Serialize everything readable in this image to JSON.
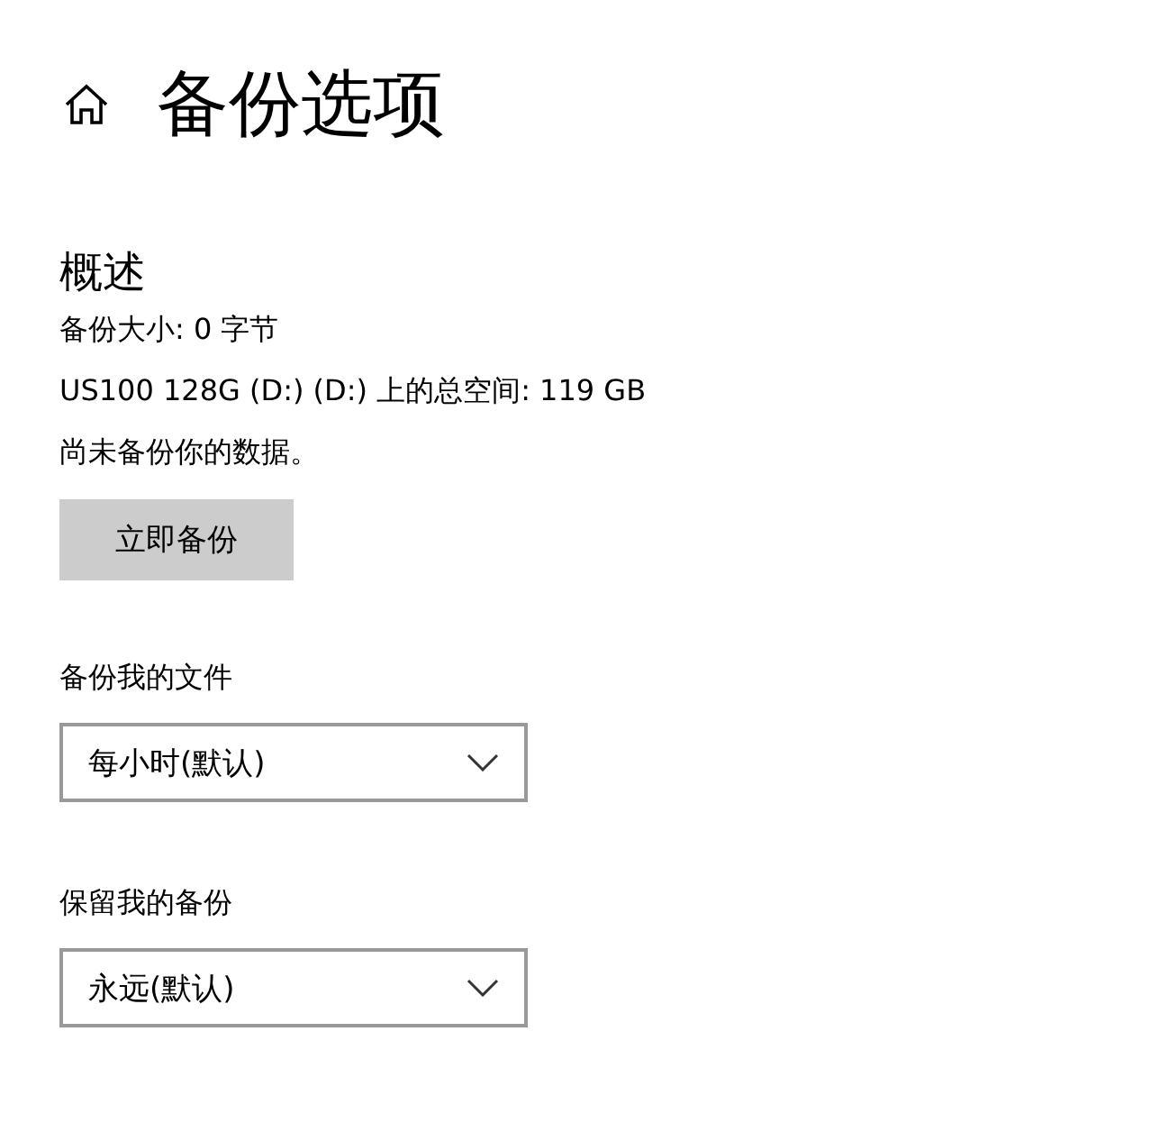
{
  "header": {
    "title": "备份选项"
  },
  "overview": {
    "heading": "概述",
    "lines": [
      "备份大小: 0 字节",
      "US100 128G (D:) (D:) 上的总空间: 119 GB",
      "尚未备份你的数据。"
    ],
    "button": "立即备份"
  },
  "settings": [
    {
      "label": "备份我的文件",
      "value": "每小时(默认)"
    },
    {
      "label": "保留我的备份",
      "value": "永远(默认)"
    }
  ]
}
